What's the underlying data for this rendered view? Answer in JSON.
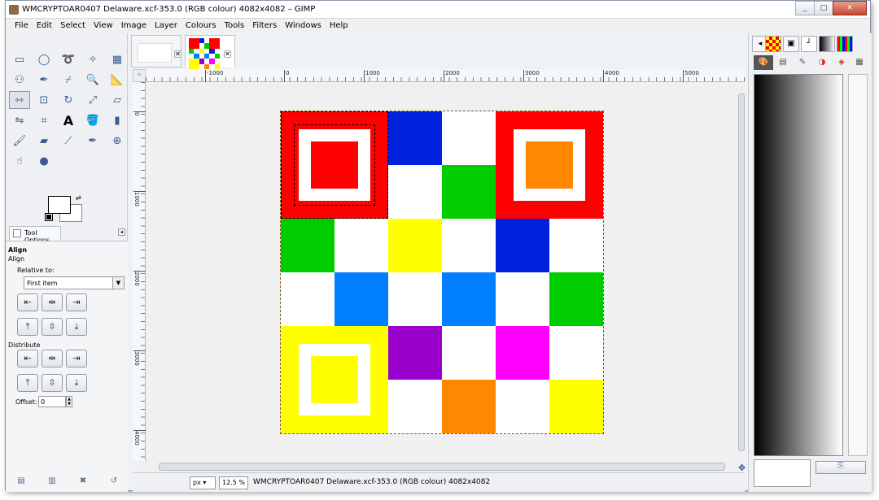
{
  "window": {
    "title": "WMCRYPTOAR0407 Delaware.xcf-353.0 (RGB colour) 4082x4082 – GIMP",
    "controls": {
      "minimize": "_",
      "maximize": "□",
      "close": "✕"
    }
  },
  "menu": [
    "File",
    "Edit",
    "Select",
    "View",
    "Image",
    "Layer",
    "Colours",
    "Tools",
    "Filters",
    "Windows",
    "Help"
  ],
  "toolbox": {
    "tools": [
      "rect-select",
      "ellipse-select",
      "free-select",
      "fuzzy-select",
      "select-by-color",
      "scissors",
      "foreground-select",
      "paths",
      "color-picker",
      "zoom",
      "measure",
      "move",
      "align",
      "crop",
      "rotate",
      "scale",
      "shear",
      "perspective",
      "flip",
      "cage",
      "text",
      "bucket-fill",
      "blend",
      "pencil",
      "paintbrush",
      "eraser",
      "airbrush",
      "ink",
      "clone",
      "heal",
      "smudge",
      "dodge-burn"
    ],
    "active_tool": "align"
  },
  "tool_options": {
    "tab_label": "Tool Options",
    "heading": "Align",
    "subheading": "Align",
    "relative_to_label": "Relative to:",
    "relative_to_value": "First item",
    "distribute_label": "Distribute",
    "offset_label": "Offset:",
    "offset_value": "0"
  },
  "image_tabs": [
    {
      "kind": "blank-thumbnail"
    },
    {
      "kind": "checker-thumbnail",
      "active": true
    }
  ],
  "canvas": {
    "ruler_h_labels": [
      "-1000",
      "0",
      "1000",
      "2000",
      "3000",
      "4000",
      "5000"
    ],
    "ruler_v_labels": [
      "0",
      "1000",
      "2000",
      "3000",
      "4000"
    ],
    "grid_colors": [
      [
        "#ff0000",
        "#ff0000",
        "#0022dd",
        "#ffffff",
        "#ff0000",
        "#ff0000"
      ],
      [
        "#ff0000",
        "#ff0000",
        "#ffffff",
        "#00cc00",
        "#ff0000",
        "#ff0000"
      ],
      [
        "#00cc00",
        "#ffffff",
        "#ffff00",
        "#ffffff",
        "#0022dd",
        "#ffffff"
      ],
      [
        "#ffffff",
        "#0080ff",
        "#ffffff",
        "#0080ff",
        "#ffffff",
        "#00cc00"
      ],
      [
        "#ffff00",
        "#ffff00",
        "#9900cc",
        "#ffffff",
        "#ff00ff",
        "#ffffff"
      ],
      [
        "#ffff00",
        "#ffff00",
        "#ffffff",
        "#ff8800",
        "#ffffff",
        "#ffff00"
      ]
    ],
    "corner_squares": [
      {
        "outer": "#ff0000",
        "inner": "#ff0000"
      },
      {
        "outer": "#ff0000",
        "inner": "#ff8800"
      },
      {
        "outer": "#ffff00",
        "inner": "#ffff00"
      }
    ]
  },
  "status": {
    "unit": "px",
    "zoom": "12.5 %",
    "text": "WMCRYPTOAR0407 Delaware.xcf-353.0 (RGB colour) 4082x4082"
  }
}
